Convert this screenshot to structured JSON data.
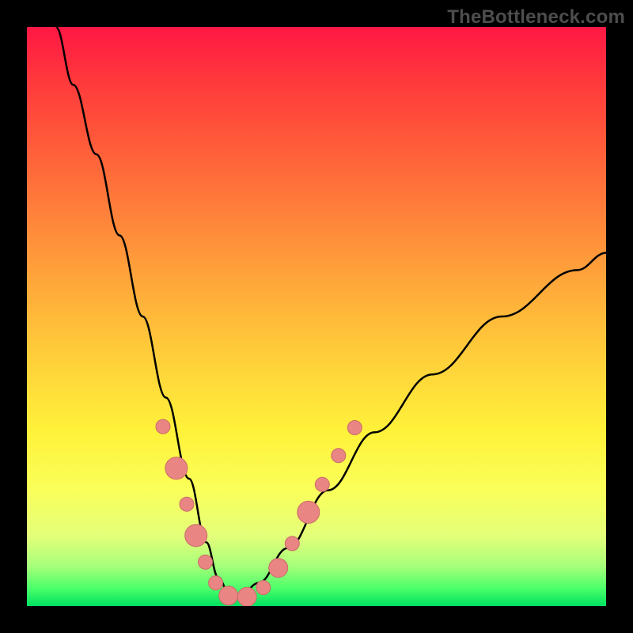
{
  "watermark": "TheBottleneck.com",
  "chart_data": {
    "type": "line",
    "title": "",
    "xlabel": "",
    "ylabel": "",
    "xlim": [
      0,
      1
    ],
    "ylim": [
      0,
      1
    ],
    "series": [
      {
        "name": "bottleneck-curve",
        "x": [
          0.05,
          0.08,
          0.12,
          0.16,
          0.2,
          0.24,
          0.28,
          0.31,
          0.33,
          0.35,
          0.37,
          0.4,
          0.45,
          0.52,
          0.6,
          0.7,
          0.82,
          0.95,
          1.0
        ],
        "y": [
          1.0,
          0.9,
          0.78,
          0.64,
          0.5,
          0.36,
          0.22,
          0.11,
          0.05,
          0.02,
          0.02,
          0.04,
          0.1,
          0.2,
          0.3,
          0.4,
          0.5,
          0.58,
          0.61
        ]
      }
    ],
    "markers": [
      {
        "x": 0.235,
        "y": 0.31,
        "r": 9
      },
      {
        "x": 0.258,
        "y": 0.238,
        "r": 14
      },
      {
        "x": 0.276,
        "y": 0.176,
        "r": 9
      },
      {
        "x": 0.292,
        "y": 0.122,
        "r": 14
      },
      {
        "x": 0.308,
        "y": 0.076,
        "r": 9
      },
      {
        "x": 0.326,
        "y": 0.04,
        "r": 9
      },
      {
        "x": 0.348,
        "y": 0.018,
        "r": 12
      },
      {
        "x": 0.38,
        "y": 0.016,
        "r": 12
      },
      {
        "x": 0.408,
        "y": 0.032,
        "r": 9
      },
      {
        "x": 0.434,
        "y": 0.066,
        "r": 12
      },
      {
        "x": 0.458,
        "y": 0.108,
        "r": 9
      },
      {
        "x": 0.486,
        "y": 0.162,
        "r": 14
      },
      {
        "x": 0.51,
        "y": 0.21,
        "r": 9
      },
      {
        "x": 0.538,
        "y": 0.26,
        "r": 9
      },
      {
        "x": 0.566,
        "y": 0.308,
        "r": 9
      }
    ],
    "colors": {
      "curve": "#000000",
      "marker_fill": "#e98583",
      "marker_stroke": "#c96b69"
    }
  }
}
